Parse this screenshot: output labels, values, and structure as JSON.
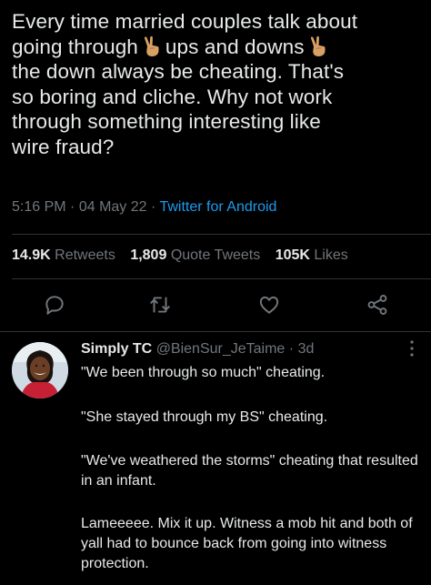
{
  "tweet": {
    "lines": [
      "Every time married couples talk about",
      [
        "going through",
        "ups and downs"
      ],
      "the down always be cheating. That's",
      "so boring and cliche. Why not work",
      "through something interesting like",
      "wire fraud?"
    ],
    "emoji": "victory-hand-emoji",
    "time": "5:16 PM",
    "date": "04 May 22",
    "separator": "·",
    "source": "Twitter for Android"
  },
  "stats": {
    "retweets_count": "14.9K",
    "retweets_label": "Retweets",
    "quotes_count": "1,809",
    "quotes_label": "Quote Tweets",
    "likes_count": "105K",
    "likes_label": "Likes"
  },
  "actions": [
    "reply-icon",
    "retweet-icon",
    "like-icon",
    "share-icon"
  ],
  "reply": {
    "name": "Simply TC",
    "handle": "@BienSur_JeTaime",
    "age": "3d",
    "more_icon": "more-options-icon",
    "paragraphs": [
      "\"We been through so much\" cheating.",
      "\"She stayed through my BS\" cheating.",
      "\"We've weathered the storms\" cheating that resulted in an infant.",
      "Lameeeee. Mix it up. Witness a mob hit and both of yall had to bounce back from going into witness protection."
    ]
  },
  "colors": {
    "background": "#000000",
    "text": "#e7e9ea",
    "muted": "#71767b",
    "link": "#1d9bf0",
    "divider": "#2f3336"
  }
}
